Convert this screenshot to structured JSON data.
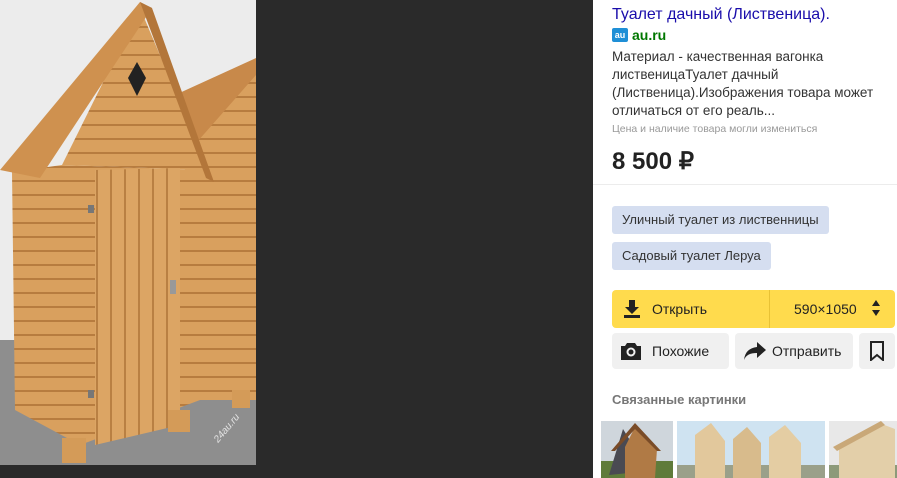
{
  "viewer": {
    "image_alt": "Туалет дачный (Лиственица)",
    "watermark": "24au.ru"
  },
  "result": {
    "title": "Туалет дачный (Лиственица).",
    "favicon_text": "au",
    "domain": "au.ru",
    "description": "Материал - качественная вагонка лиственицаТуалет дачный (Лиственица).Изображения товара может отличаться от его реаль...",
    "notice": "Цена и наличие товара могли измениться",
    "price": "8 500 ₽"
  },
  "tags": [
    {
      "label": "Уличный туалет из лиственницы"
    },
    {
      "label": "Садовый туалет Леруа"
    }
  ],
  "actions": {
    "open_label": "Открыть",
    "size_label": "590×1050",
    "similar_label": "Похожие",
    "share_label": "Отправить"
  },
  "related": {
    "heading": "Связанные картинки"
  },
  "colors": {
    "accent": "#ffdb4d",
    "link": "#1a0dab",
    "domain": "#007700",
    "tag_bg": "#d5def0"
  }
}
